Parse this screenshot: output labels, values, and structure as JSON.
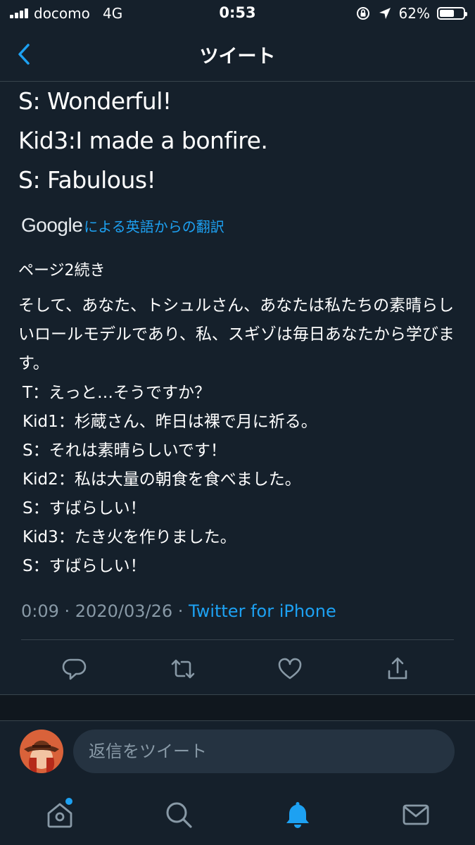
{
  "status_bar": {
    "carrier": "docomo",
    "network": "4G",
    "time": "0:53",
    "battery": "62%",
    "battery_level": 0.62
  },
  "nav": {
    "title": "ツイート"
  },
  "tweet": {
    "big_lines": [
      "S: Wonderful!",
      "Kid3:I made a bonfire.",
      "S: Fabulous!"
    ],
    "translation_brand": "Google",
    "translation_label": "による英語からの翻訳",
    "page_note": "ページ2続き",
    "paragraph": "そして、あなた、トシュルさん、あなたは私たちの素晴らしいロールモデルであり、私、スギゾは毎日あなたから学びます。",
    "lines": [
      "T：えっと…そうですか？",
      "Kid1：杉蔵さん、昨日は裸で月に祈る。",
      "S：それは素晴らしいです！",
      "Kid2：私は大量の朝食を食べました。",
      "S：すばらしい！",
      "Kid3：たき火を作りました。",
      "S：すばらしい！"
    ],
    "meta_time": "0:09 · 2020/03/26 · ",
    "meta_app": "Twitter for iPhone"
  },
  "reply": {
    "placeholder": "返信をツイート"
  },
  "colors": {
    "background": "#15202b",
    "accent": "#1da1f2",
    "muted": "#8899a6",
    "divider": "#38444d"
  },
  "icons": [
    "back-chevron-icon",
    "reply-icon",
    "retweet-icon",
    "like-icon",
    "share-icon",
    "home-icon",
    "search-icon",
    "notifications-icon",
    "messages-icon"
  ]
}
